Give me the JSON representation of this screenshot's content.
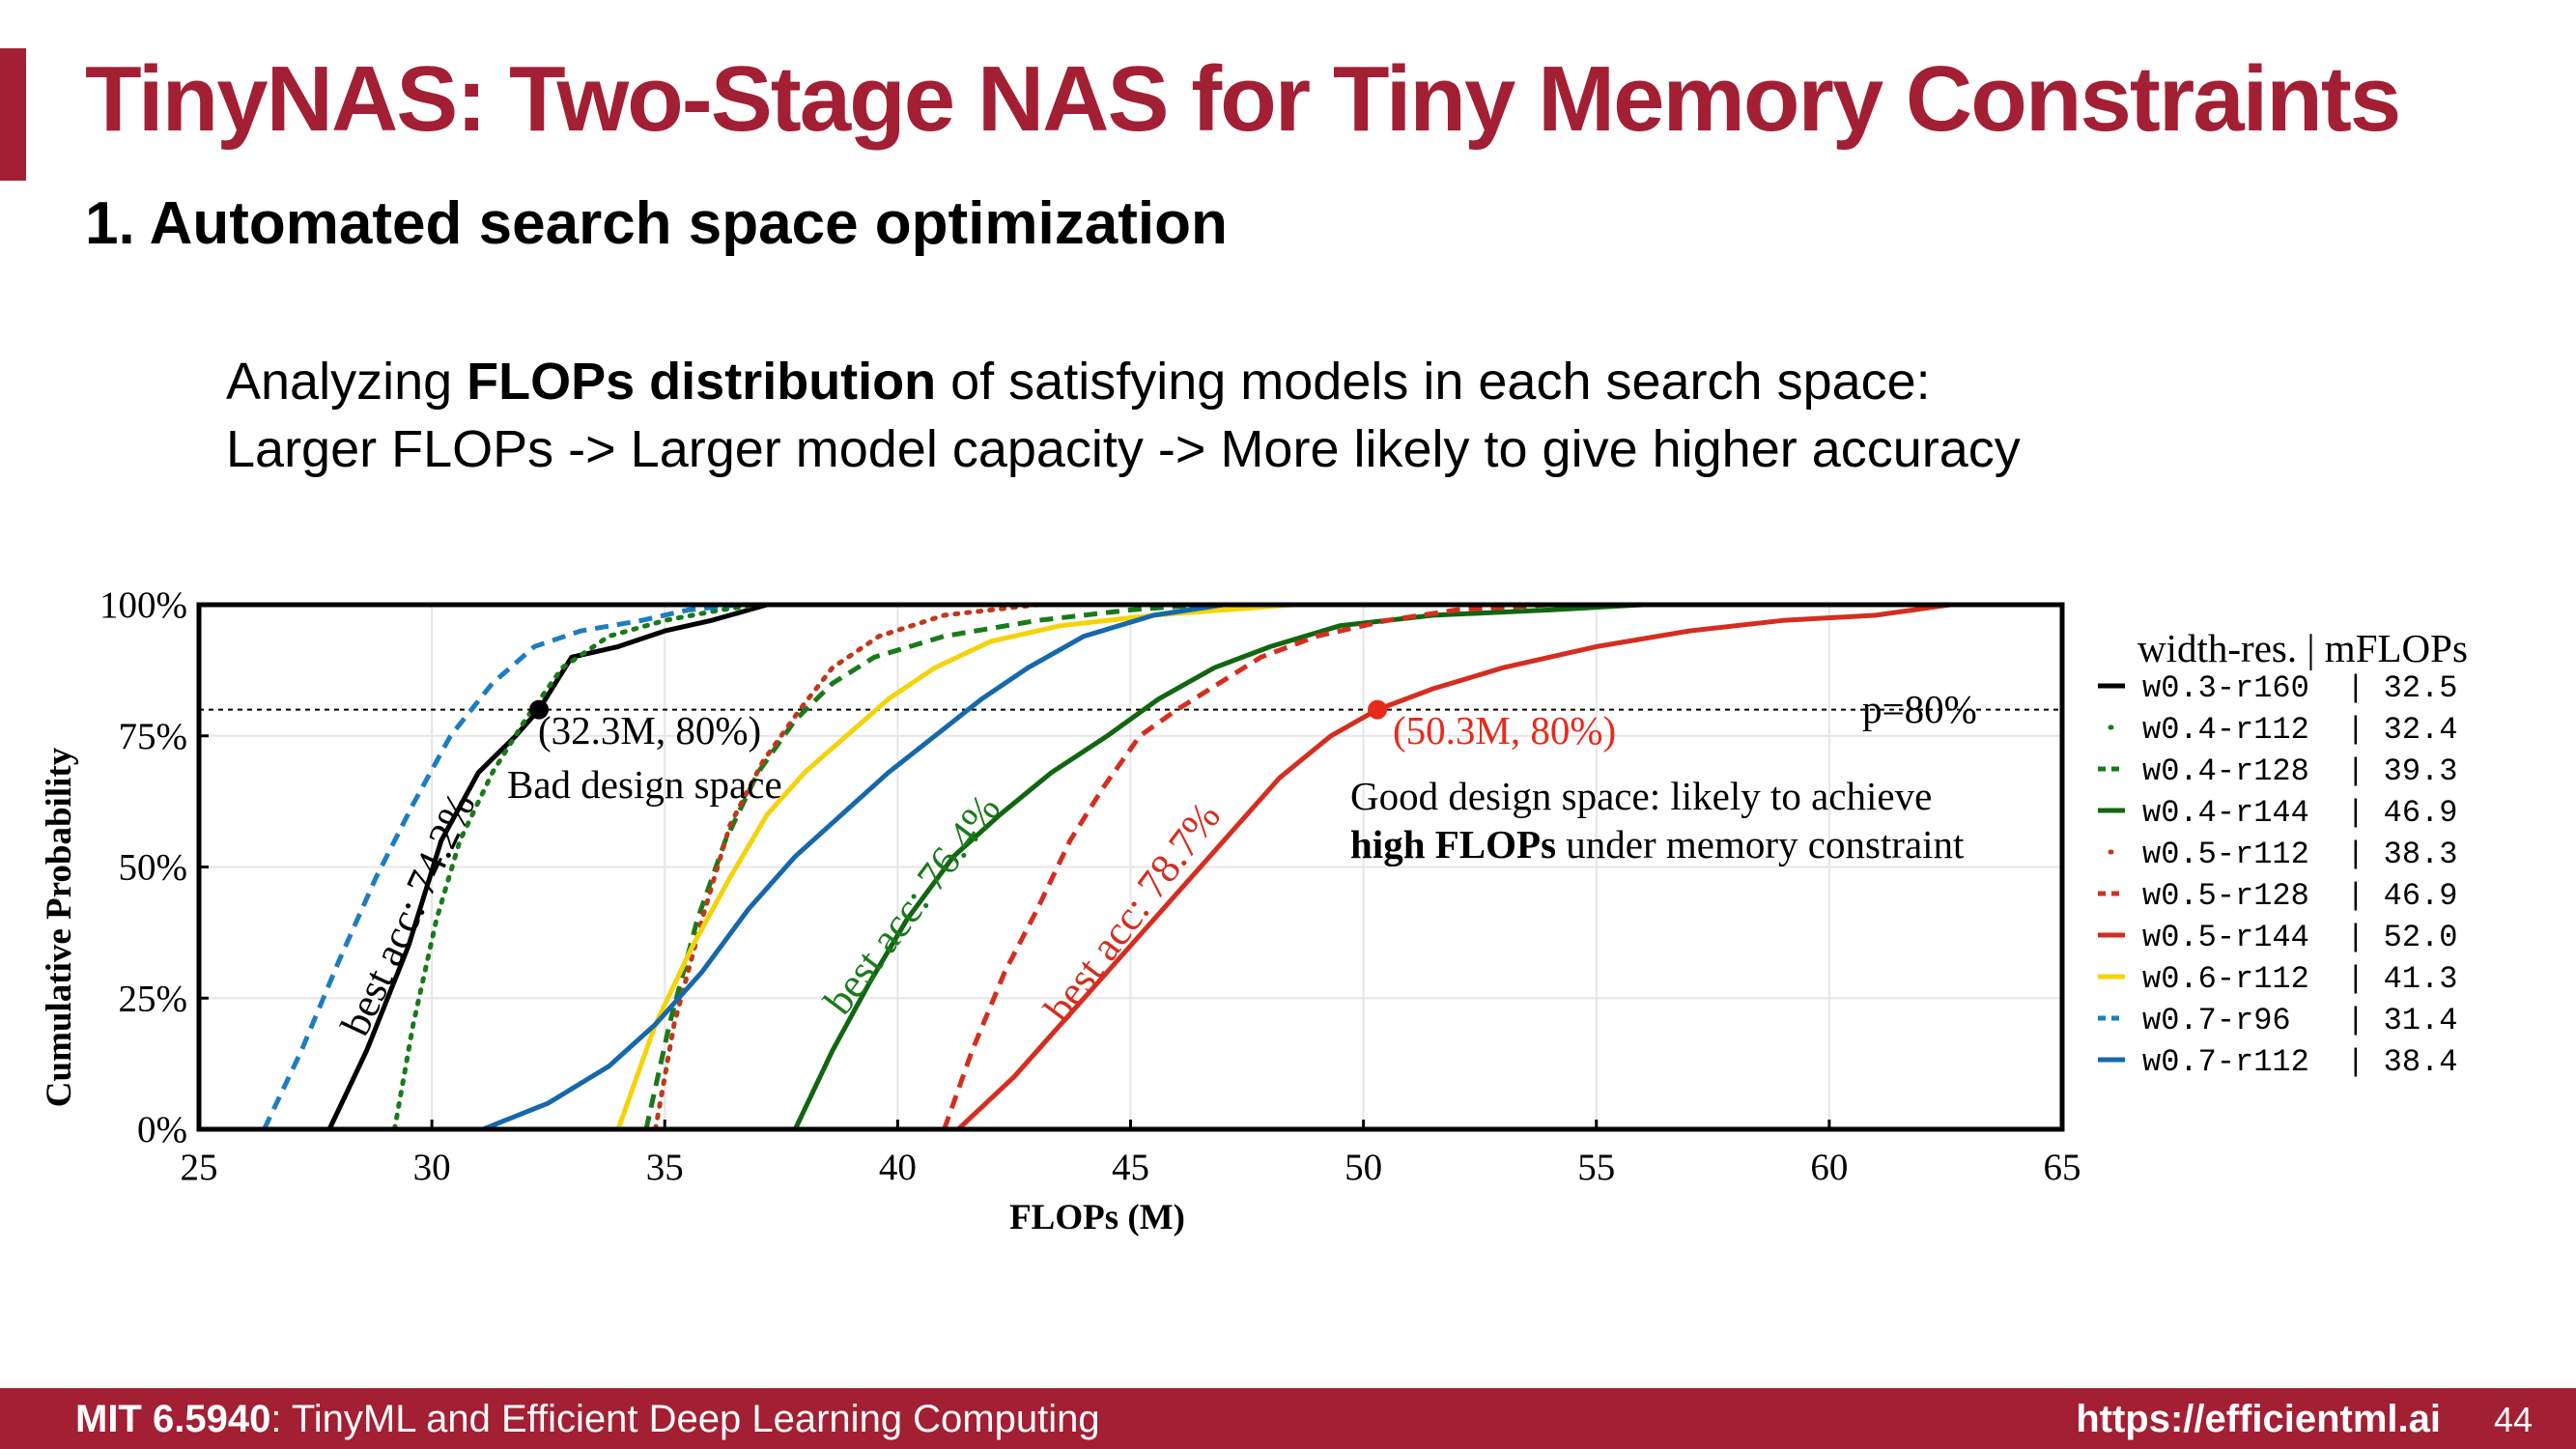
{
  "slide": {
    "title": "TinyNAS: Two-Stage NAS for Tiny Memory Constraints",
    "subtitle": "1. Automated search space optimization",
    "line1_pre": "Analyzing ",
    "line1_bold": "FLOPs distribution",
    "line1_post": " of satisfying models in each search space:",
    "line2": "Larger FLOPs -> Larger model capacity -> More likely to give higher accuracy",
    "accent_color": "#a31f34"
  },
  "footer": {
    "course": "MIT 6.5940",
    "course_title": ": TinyML and Efficient Deep Learning Computing",
    "url": "https://efficientml.ai",
    "page": "44"
  },
  "chart_data": {
    "type": "line",
    "xlabel": "FLOPs (M)",
    "ylabel": "Cumulative Probability",
    "xlim": [
      25,
      65
    ],
    "ylim": [
      0,
      100
    ],
    "xticks": [
      25,
      30,
      35,
      40,
      45,
      50,
      55,
      60,
      65
    ],
    "yticks": [
      0,
      25,
      50,
      75,
      100
    ],
    "ytick_labels": [
      "0%",
      "25%",
      "50%",
      "75%",
      "100%"
    ],
    "grid": true,
    "legend_title": "width-res. | mFLOPs",
    "legend_position": "right-outside",
    "reference_line": {
      "y": 80,
      "label": "p=80%"
    },
    "series": [
      {
        "name": "w0.3-r160",
        "mflops": "32.5",
        "color": "#000000",
        "dash": "solid",
        "x": [
          27.8,
          28.6,
          29.5,
          30.2,
          31.0,
          31.8,
          32.3,
          33.0,
          34.0,
          35.0,
          36.0,
          36.8,
          37.2
        ],
        "y": [
          0,
          15,
          35,
          55,
          68,
          75,
          80,
          90,
          92,
          95,
          97,
          99,
          100
        ]
      },
      {
        "name": "w0.4-r112",
        "mflops": "32.4",
        "color": "#1a7a1a",
        "dash": "dotted",
        "x": [
          29.2,
          29.6,
          30.1,
          30.6,
          31.3,
          32.0,
          32.8,
          33.8,
          35.0,
          36.2,
          37.0
        ],
        "y": [
          0,
          20,
          40,
          55,
          68,
          78,
          88,
          94,
          97,
          99,
          100
        ]
      },
      {
        "name": "w0.4-r128",
        "mflops": "39.3",
        "color": "#1a7a1a",
        "dash": "dashed",
        "x": [
          34.6,
          35.1,
          35.7,
          36.3,
          37.0,
          37.8,
          38.6,
          39.5,
          41.0,
          43.0,
          45.0,
          46.5
        ],
        "y": [
          0,
          20,
          40,
          55,
          68,
          78,
          85,
          90,
          94,
          97,
          99,
          100
        ]
      },
      {
        "name": "w0.4-r144",
        "mflops": "46.9",
        "color": "#116611",
        "dash": "solid",
        "x": [
          37.8,
          38.6,
          39.4,
          40.2,
          41.2,
          42.2,
          43.3,
          44.5,
          45.6,
          46.8,
          48.0,
          49.5,
          51.5,
          54.0,
          56.0
        ],
        "y": [
          0,
          15,
          28,
          40,
          52,
          60,
          68,
          75,
          82,
          88,
          92,
          96,
          98,
          99,
          100
        ]
      },
      {
        "name": "w0.5-r112",
        "mflops": "38.3",
        "color": "#c0391b",
        "dash": "dotted",
        "x": [
          34.8,
          35.2,
          35.8,
          36.4,
          37.1,
          37.9,
          38.6,
          39.6,
          41.0,
          43.0
        ],
        "y": [
          0,
          20,
          40,
          58,
          70,
          80,
          88,
          94,
          98,
          100
        ]
      },
      {
        "name": "w0.5-r128",
        "mflops": "46.9",
        "color": "#d42e20",
        "dash": "dashed",
        "x": [
          41.0,
          41.6,
          42.3,
          43.0,
          43.7,
          44.4,
          45.2,
          46.0,
          46.9,
          47.8,
          49.0,
          50.5,
          52.0,
          54.0
        ],
        "y": [
          0,
          15,
          30,
          42,
          55,
          65,
          75,
          80,
          85,
          90,
          94,
          97,
          99,
          100
        ]
      },
      {
        "name": "w0.5-r144",
        "mflops": "52.0",
        "color": "#d42e20",
        "dash": "solid",
        "x": [
          41.3,
          42.5,
          44.0,
          45.5,
          47.0,
          48.2,
          49.3,
          50.3,
          51.5,
          53.0,
          55.0,
          57.0,
          59.0,
          61.0,
          62.6
        ],
        "y": [
          0,
          10,
          25,
          40,
          55,
          67,
          75,
          80,
          84,
          88,
          92,
          95,
          97,
          98,
          100
        ]
      },
      {
        "name": "w0.6-r112",
        "mflops": "41.3",
        "color": "#f5d30a",
        "dash": "solid",
        "x": [
          34.0,
          34.8,
          35.6,
          36.4,
          37.2,
          38.0,
          38.9,
          39.8,
          40.8,
          42.0,
          43.5,
          45.5,
          48.5
        ],
        "y": [
          0,
          20,
          35,
          48,
          60,
          68,
          75,
          82,
          88,
          93,
          96,
          98,
          100
        ]
      },
      {
        "name": "w0.7-r96",
        "mflops": "31.4",
        "color": "#1e7dc0",
        "dash": "dashed",
        "x": [
          26.4,
          27.2,
          28.0,
          28.8,
          29.6,
          30.4,
          31.3,
          32.2,
          33.2,
          34.5,
          35.5,
          36.6
        ],
        "y": [
          0,
          15,
          32,
          48,
          62,
          75,
          85,
          92,
          95,
          97,
          99,
          100
        ]
      },
      {
        "name": "w0.7-r112",
        "mflops": "38.4",
        "color": "#1668ab",
        "dash": "solid",
        "x": [
          31.1,
          32.5,
          33.8,
          34.8,
          35.8,
          36.8,
          37.8,
          38.8,
          39.8,
          40.8,
          41.8,
          42.8,
          44.0,
          45.5,
          47.0
        ],
        "y": [
          0,
          5,
          12,
          20,
          30,
          42,
          52,
          60,
          68,
          75,
          82,
          88,
          94,
          98,
          100
        ]
      }
    ],
    "points": [
      {
        "x": 32.3,
        "y": 80,
        "label": "(32.3M, 80%)",
        "color": "#000000"
      },
      {
        "x": 50.3,
        "y": 80,
        "label": "(50.3M, 80%)",
        "color": "#e8291c"
      }
    ],
    "annotations": {
      "bad_space": "Bad design space",
      "good_line1": "Good design space: likely to achieve",
      "good_line2_bold": "high FLOPs",
      "good_line2_rest": " under memory constraint",
      "acc_black": "best acc: 74.2%",
      "acc_green": "best acc: 76.4%",
      "acc_red": "best acc: 78.7%"
    }
  }
}
